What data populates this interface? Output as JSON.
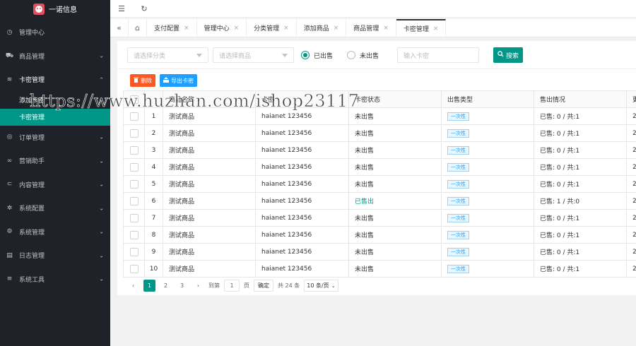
{
  "brand": {
    "name": "一诺信息"
  },
  "sidebar": {
    "items": [
      {
        "label": "管理中心",
        "icon": "dashboard-icon",
        "arrow": ""
      },
      {
        "label": "商品管理",
        "icon": "cart-icon",
        "arrow": "⌄"
      },
      {
        "label": "卡密管理",
        "icon": "layers-icon",
        "arrow": "⌃",
        "open": true,
        "children": [
          {
            "label": "添加卡密",
            "active": false
          },
          {
            "label": "卡密管理",
            "active": true
          }
        ]
      },
      {
        "label": "订单管理",
        "icon": "order-icon",
        "arrow": "⌄"
      },
      {
        "label": "营销助手",
        "icon": "link-icon",
        "arrow": "⌄"
      },
      {
        "label": "内容管理",
        "icon": "content-icon",
        "arrow": "⌄"
      },
      {
        "label": "系统配置",
        "icon": "gear-icon",
        "arrow": "⌄"
      },
      {
        "label": "系统管理",
        "icon": "settings-icon",
        "arrow": "⌄"
      },
      {
        "label": "日志管理",
        "icon": "log-icon",
        "arrow": "⌄"
      },
      {
        "label": "系统工具",
        "icon": "tools-icon",
        "arrow": "⌄"
      }
    ]
  },
  "tabs": [
    {
      "label": "支付配置",
      "active": false
    },
    {
      "label": "管理中心",
      "active": false
    },
    {
      "label": "分类管理",
      "active": false
    },
    {
      "label": "添加商品",
      "active": false
    },
    {
      "label": "商品管理",
      "active": false
    },
    {
      "label": "卡密管理",
      "active": true
    }
  ],
  "filters": {
    "category_placeholder": "请选择分类",
    "product_placeholder": "请选择商品",
    "radio_sold": "已出售",
    "radio_unsold": "未出售",
    "card_placeholder": "输入卡密",
    "search_label": "搜索"
  },
  "toolbar": {
    "delete_label": "删除",
    "export_label": "导出卡密"
  },
  "table": {
    "headers": [
      "",
      "",
      "商品名称",
      "卡密",
      "卡密状态",
      "出售类型",
      "售出情况",
      "更"
    ],
    "rows": [
      {
        "no": "1",
        "name": "测试商品",
        "card": "haianet 123456",
        "status": "未出售",
        "type": "一次性",
        "sold": "已售: 0 / 共:1",
        "extra": "2"
      },
      {
        "no": "2",
        "name": "测试商品",
        "card": "haianet 123456",
        "status": "未出售",
        "type": "一次性",
        "sold": "已售: 0 / 共:1",
        "extra": "2"
      },
      {
        "no": "3",
        "name": "测试商品",
        "card": "haianet 123456",
        "status": "未出售",
        "type": "一次性",
        "sold": "已售: 0 / 共:1",
        "extra": "2"
      },
      {
        "no": "4",
        "name": "测试商品",
        "card": "haianet 123456",
        "status": "未出售",
        "type": "一次性",
        "sold": "已售: 0 / 共:1",
        "extra": "2"
      },
      {
        "no": "5",
        "name": "测试商品",
        "card": "haianet 123456",
        "status": "未出售",
        "type": "一次性",
        "sold": "已售: 0 / 共:1",
        "extra": "2"
      },
      {
        "no": "6",
        "name": "测试商品",
        "card": "haianet 123456",
        "status": "已售出",
        "type": "一次性",
        "sold": "已售: 1 / 共:0",
        "extra": "2"
      },
      {
        "no": "7",
        "name": "测试商品",
        "card": "haianet 123456",
        "status": "未出售",
        "type": "一次性",
        "sold": "已售: 0 / 共:1",
        "extra": "2"
      },
      {
        "no": "8",
        "name": "测试商品",
        "card": "haianet 123456",
        "status": "未出售",
        "type": "一次性",
        "sold": "已售: 0 / 共:1",
        "extra": "2"
      },
      {
        "no": "9",
        "name": "测试商品",
        "card": "haianet 123456",
        "status": "未出售",
        "type": "一次性",
        "sold": "已售: 0 / 共:1",
        "extra": "2"
      },
      {
        "no": "10",
        "name": "测试商品",
        "card": "haianet 123456",
        "status": "未出售",
        "type": "一次性",
        "sold": "已售: 0 / 共:1",
        "extra": "2"
      }
    ]
  },
  "pager": {
    "pages": [
      "1",
      "2",
      "3"
    ],
    "current": "1",
    "goto_prefix": "到第",
    "goto_value": "1",
    "goto_suffix": "页",
    "confirm": "确定",
    "total": "共 24 条",
    "page_size": "10 条/页"
  },
  "watermark": "https://www.huzhan.com/ishop23117",
  "colors": {
    "accent": "#009688",
    "sidebar_bg": "#20222a",
    "delete": "#ff5722",
    "export": "#1e9fff"
  }
}
